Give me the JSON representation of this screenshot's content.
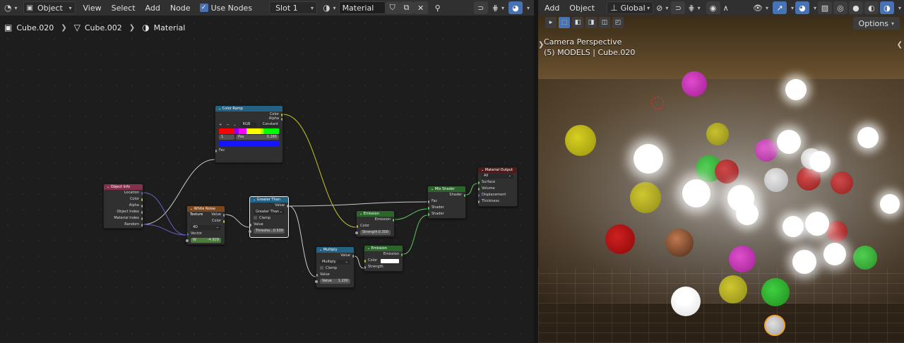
{
  "node_editor": {
    "header": {
      "mode_label": "Object",
      "menus": [
        "View",
        "Select",
        "Add",
        "Node"
      ],
      "use_nodes_label": "Use Nodes",
      "slot_label": "Slot 1",
      "material_name": "Material"
    },
    "breadcrumb": [
      "Cube.020",
      "Cube.002",
      "Material"
    ],
    "nodes": {
      "color_ramp": {
        "title": "Color Ramp",
        "out_color": "Color",
        "out_alpha": "Alpha",
        "color_mode": "RGB",
        "interpolation": "Constant",
        "stop_index": "1",
        "pos_label": "Pos",
        "pos_value": "0.280",
        "in_fac": "Fac"
      },
      "object_info": {
        "title": "Object Info",
        "outputs": [
          "Location",
          "Color",
          "Alpha",
          "Object Index",
          "Material Index",
          "Random"
        ]
      },
      "white_noise": {
        "title": "White Noise Texture",
        "out_value": "Value",
        "out_color": "Color",
        "dimensions": "4D",
        "in_vector": "Vector",
        "w_label": "W",
        "w_value": "-4.929"
      },
      "greater_than": {
        "title": "Greater Than",
        "out_value": "Value",
        "operation": "Greater Than",
        "clamp_label": "Clamp",
        "in_value": "Value",
        "threshold_label": "Thresho...",
        "threshold_value": "0.500"
      },
      "multiply": {
        "title": "Multiply",
        "out_value": "Value",
        "operation": "Multiply",
        "clamp_label": "Clamp",
        "in_value": "Value",
        "value_label": "Value",
        "value_value": "1.200"
      },
      "emission1": {
        "title": "Emission",
        "out": "Emission",
        "in_color": "Color",
        "strength_label": "Strength",
        "strength_value": "0.300"
      },
      "emission2": {
        "title": "Emission",
        "out": "Emission",
        "in_color": "Color",
        "in_strength": "Strength"
      },
      "mix_shader": {
        "title": "Mix Shader",
        "out": "Shader",
        "in_fac": "Fac",
        "in_shader1": "Shader",
        "in_shader2": "Shader"
      },
      "material_output": {
        "title": "Material Output",
        "target": "All",
        "inputs": [
          "Surface",
          "Volume",
          "Displacement",
          "Thickness"
        ]
      }
    },
    "colors": {
      "header_input": "#83314a",
      "header_texture": "#79461d",
      "header_converter": "#246283",
      "header_shader": "#2b652b",
      "header_output": "#4c1a1a",
      "socket_vector": "#6363c7",
      "socket_color": "#c7c729",
      "socket_float": "#a1a1a1",
      "socket_shader": "#63c763"
    }
  },
  "viewport": {
    "header": {
      "menus": [
        "Add",
        "Object"
      ],
      "orientation": "Global"
    },
    "options_label": "Options",
    "camera_label": "Camera Perspective",
    "collection_label": "(5) MODELS | Cube.020"
  }
}
